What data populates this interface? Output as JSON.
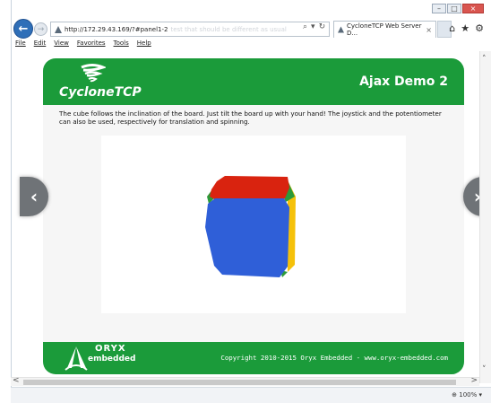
{
  "browser": {
    "address_url": "http://172.29.43.169/?#panel1-2",
    "address_ghost": "test that should be different as usual",
    "tab_title": "CycloneTCP Web Server D...",
    "tab_close": "×",
    "menu": [
      "File",
      "Edit",
      "View",
      "Favorites",
      "Tools",
      "Help"
    ],
    "zoom": "100%",
    "caption": {
      "minimize": "–",
      "maximize": "□",
      "close": "×"
    },
    "nav": {
      "back": "←",
      "forward": "→"
    },
    "address_tools": [
      "⌕",
      "▾",
      "↻"
    ],
    "tools_right": [
      "⌂",
      "★",
      "⚙"
    ],
    "flip_prev": "‹",
    "flip_next": "›",
    "scroll_up": "˄",
    "scroll_down": "˅",
    "scroll_left": "<",
    "scroll_right": ">"
  },
  "page": {
    "logo_text": "CycloneTCP",
    "title": "Ajax Demo 2",
    "description": "The cube follows the inclination of the board. Just tilt the board up with your hand! The joystick and the potentiometer can also be used, respectively for translation and spinning.",
    "footer_logo_top": "ORYX",
    "footer_logo_bottom": "embedded",
    "copyright": "Copyright 2010-2015 Oryx Embedded - www.oryx-embedded.com"
  },
  "colors": {
    "header_green": "#1b9b3a",
    "cube_front": "#2f5fd8",
    "cube_top": "#d9230f",
    "cube_right": "#f5c10a",
    "cube_edge": "#2c9a3a"
  },
  "icons": {
    "back": "back-arrow-icon",
    "forward": "forward-arrow-icon",
    "home": "home-icon",
    "favorites": "star-icon",
    "settings": "gear-icon"
  }
}
